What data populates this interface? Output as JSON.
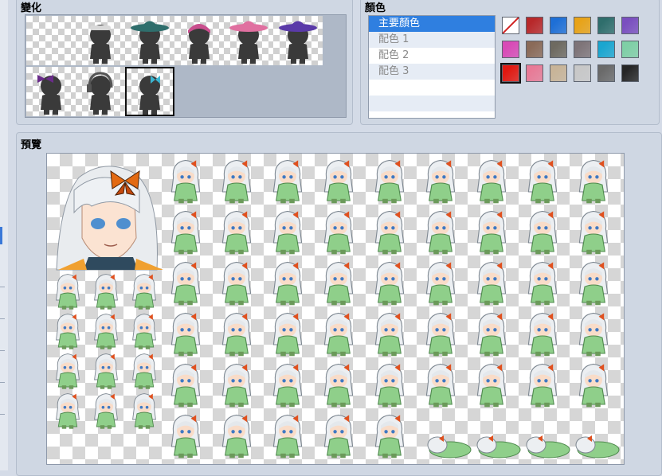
{
  "variation": {
    "title": "變化",
    "items": [
      {
        "icon": "none-icon",
        "selected": false
      },
      {
        "icon": "goggles-icon",
        "selected": false
      },
      {
        "icon": "witch-hat-green-icon",
        "selected": false
      },
      {
        "icon": "pink-ribbon-icon",
        "selected": false
      },
      {
        "icon": "flower-hat-icon",
        "selected": false
      },
      {
        "icon": "witch-hat-purple-icon",
        "selected": false
      },
      {
        "icon": "bow-icon",
        "selected": false
      },
      {
        "icon": "headset-icon",
        "selected": false
      },
      {
        "icon": "butterfly-clip-icon",
        "selected": true
      }
    ]
  },
  "color": {
    "title": "顏色",
    "list": [
      {
        "label": "主要顏色",
        "selected": true
      },
      {
        "label": "配色 1",
        "selected": false
      },
      {
        "label": "配色 2",
        "selected": false
      },
      {
        "label": "配色 3",
        "selected": false
      }
    ],
    "swatches": [
      "none",
      "#b8282a",
      "#1e6fd6",
      "#e8a318",
      "#2f6e6c",
      "#7a4fbf",
      "#d84ab6",
      "#8a6a58",
      "#6e6a60",
      "#7e7478",
      "#1aa6d0",
      "#7fcfa6",
      "#e01810",
      "#e87a96",
      "#c8b498",
      "#c8c8c8",
      "#6a6a6a",
      "#262626"
    ],
    "selected_swatch": 12
  },
  "preview": {
    "title": "預覽"
  }
}
